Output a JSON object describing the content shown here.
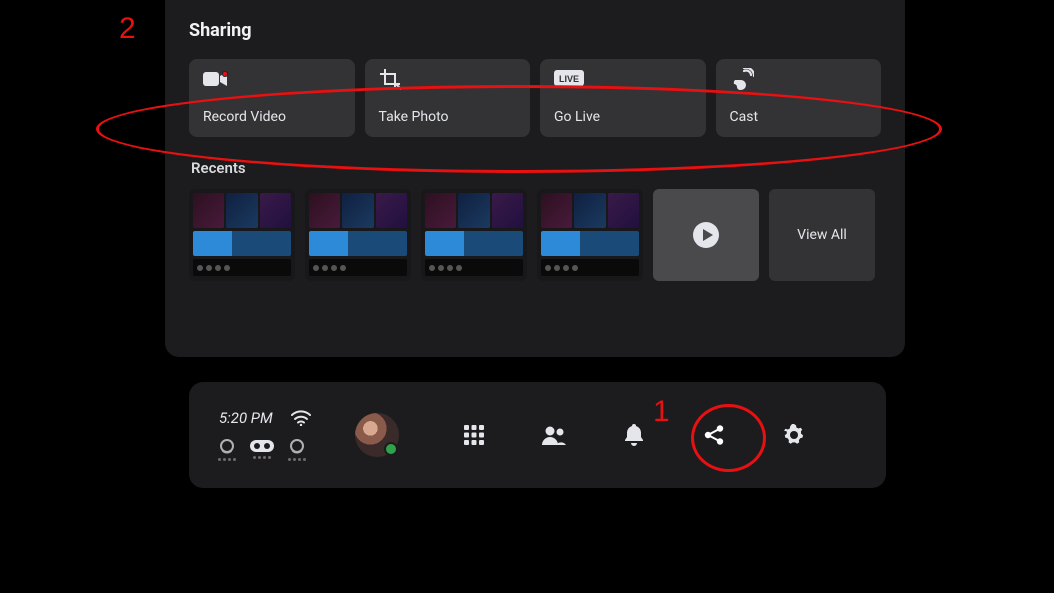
{
  "panel": {
    "title": "Sharing",
    "options": [
      {
        "id": "record-video",
        "label": "Record Video",
        "icon": "video-camera-icon"
      },
      {
        "id": "take-photo",
        "label": "Take Photo",
        "icon": "crop-camera-icon"
      },
      {
        "id": "go-live",
        "label": "Go Live",
        "icon": "live-badge-icon"
      },
      {
        "id": "cast",
        "label": "Cast",
        "icon": "cast-icon"
      }
    ],
    "recents": {
      "title": "Recents",
      "thumbnails": [
        {
          "id": "recent-1",
          "type": "screenshot"
        },
        {
          "id": "recent-2",
          "type": "screenshot"
        },
        {
          "id": "recent-3",
          "type": "screenshot"
        },
        {
          "id": "recent-4",
          "type": "screenshot"
        }
      ],
      "play_button": "play",
      "view_all_label": "View All"
    }
  },
  "dock": {
    "time": "5:20 PM",
    "wifi": "wifi-icon",
    "quick_pills": [
      {
        "id": "headset-left",
        "icon": "oculus-headset-icon"
      },
      {
        "id": "vr-goggles",
        "icon": "vr-goggles-icon"
      },
      {
        "id": "headset-right",
        "icon": "oculus-mirror-icon"
      }
    ],
    "avatar": {
      "status": "online"
    },
    "items": [
      {
        "id": "apps",
        "icon": "apps-grid-icon",
        "active": false
      },
      {
        "id": "people",
        "icon": "people-icon",
        "active": false
      },
      {
        "id": "notifications",
        "icon": "bell-icon",
        "active": false
      },
      {
        "id": "share",
        "icon": "share-icon",
        "active": true
      },
      {
        "id": "settings",
        "icon": "gear-icon",
        "active": false
      }
    ]
  },
  "annotations": {
    "label1": "1",
    "label2": "2",
    "colors": {
      "annotation": "#e81010",
      "accent": "#1877f2"
    }
  }
}
